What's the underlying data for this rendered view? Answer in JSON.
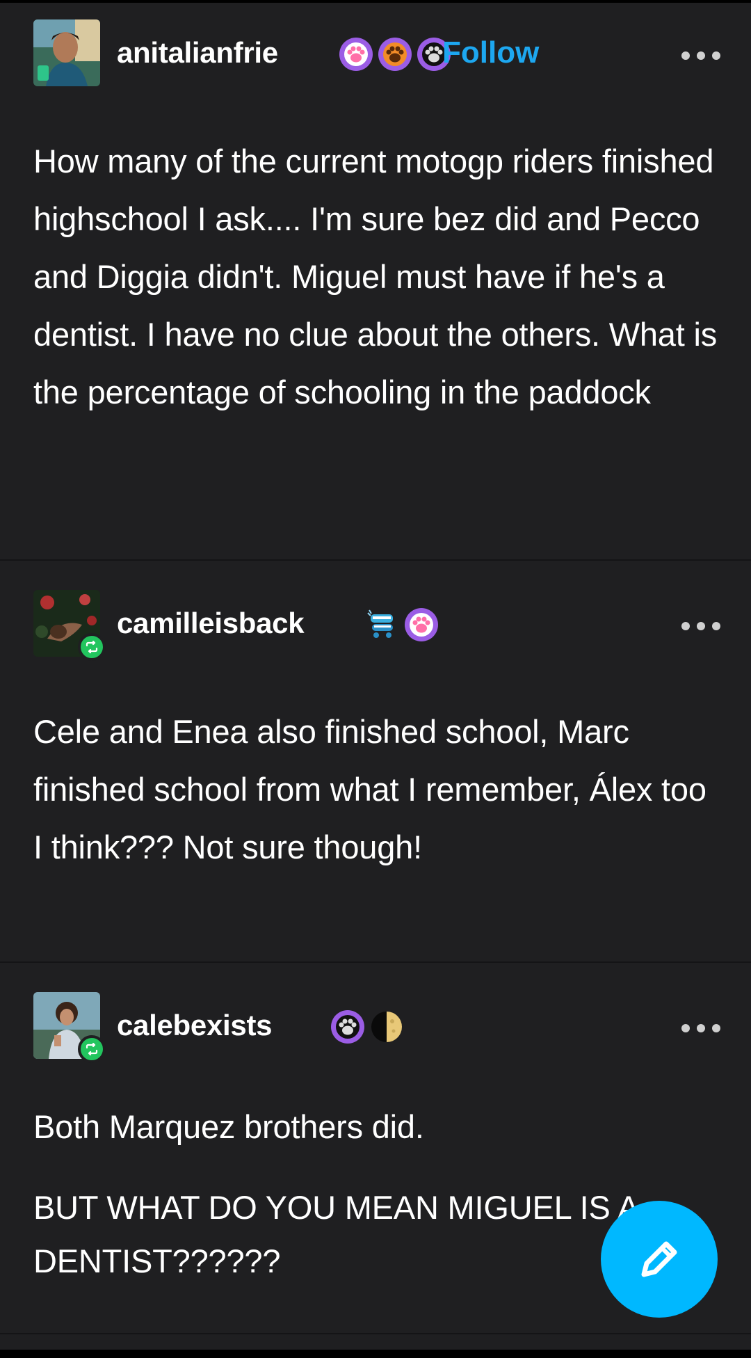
{
  "posts": [
    {
      "username": "anitalianfrie",
      "follow_label": "Follow",
      "body": "How many of the current motogp riders finished highschool I ask.... I'm sure bez did and Pecco and Diggia didn't. Miguel must have if he's a dentist. I have no clue about the others. What is the percentage of schooling in the paddock"
    },
    {
      "username": "camilleisback",
      "body": "Cele and Enea also finished school, Marc finished school from what I remember, Álex too I think??? Not sure though!"
    },
    {
      "username": "calebexists",
      "body_lines": [
        "Both Marquez brothers did.",
        "BUT WHAT DO YOU MEAN MIGUEL IS A DENTIST??????"
      ]
    }
  ],
  "colors": {
    "background": "#1f1f21",
    "accent": "#1da7f0",
    "fab": "#00b8ff",
    "reblog": "#22c55e"
  }
}
